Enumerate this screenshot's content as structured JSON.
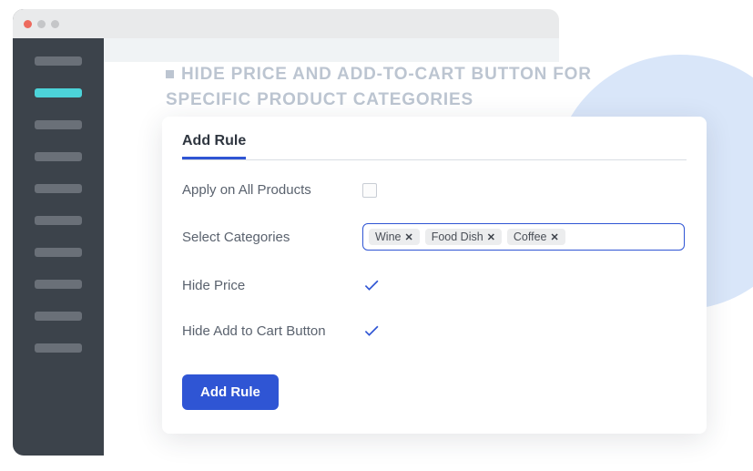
{
  "page": {
    "title": "HIDE PRICE AND ADD-TO-CART BUTTON FOR SPECIFIC PRODUCT CATEGORIES"
  },
  "card": {
    "tab_label": "Add Rule",
    "apply_all_label": "Apply on All Products",
    "select_categories_label": "Select Categories",
    "hide_price_label": "Hide Price",
    "hide_cart_label": "Hide Add to Cart Button",
    "add_rule_button": "Add Rule",
    "categories": [
      {
        "label": "Wine"
      },
      {
        "label": "Food Dish"
      },
      {
        "label": "Coffee"
      }
    ],
    "apply_all_checked": false,
    "hide_price_checked": true,
    "hide_cart_checked": true
  },
  "colors": {
    "accent": "#2f55d4",
    "sidebar_active": "#4cd3d9"
  }
}
